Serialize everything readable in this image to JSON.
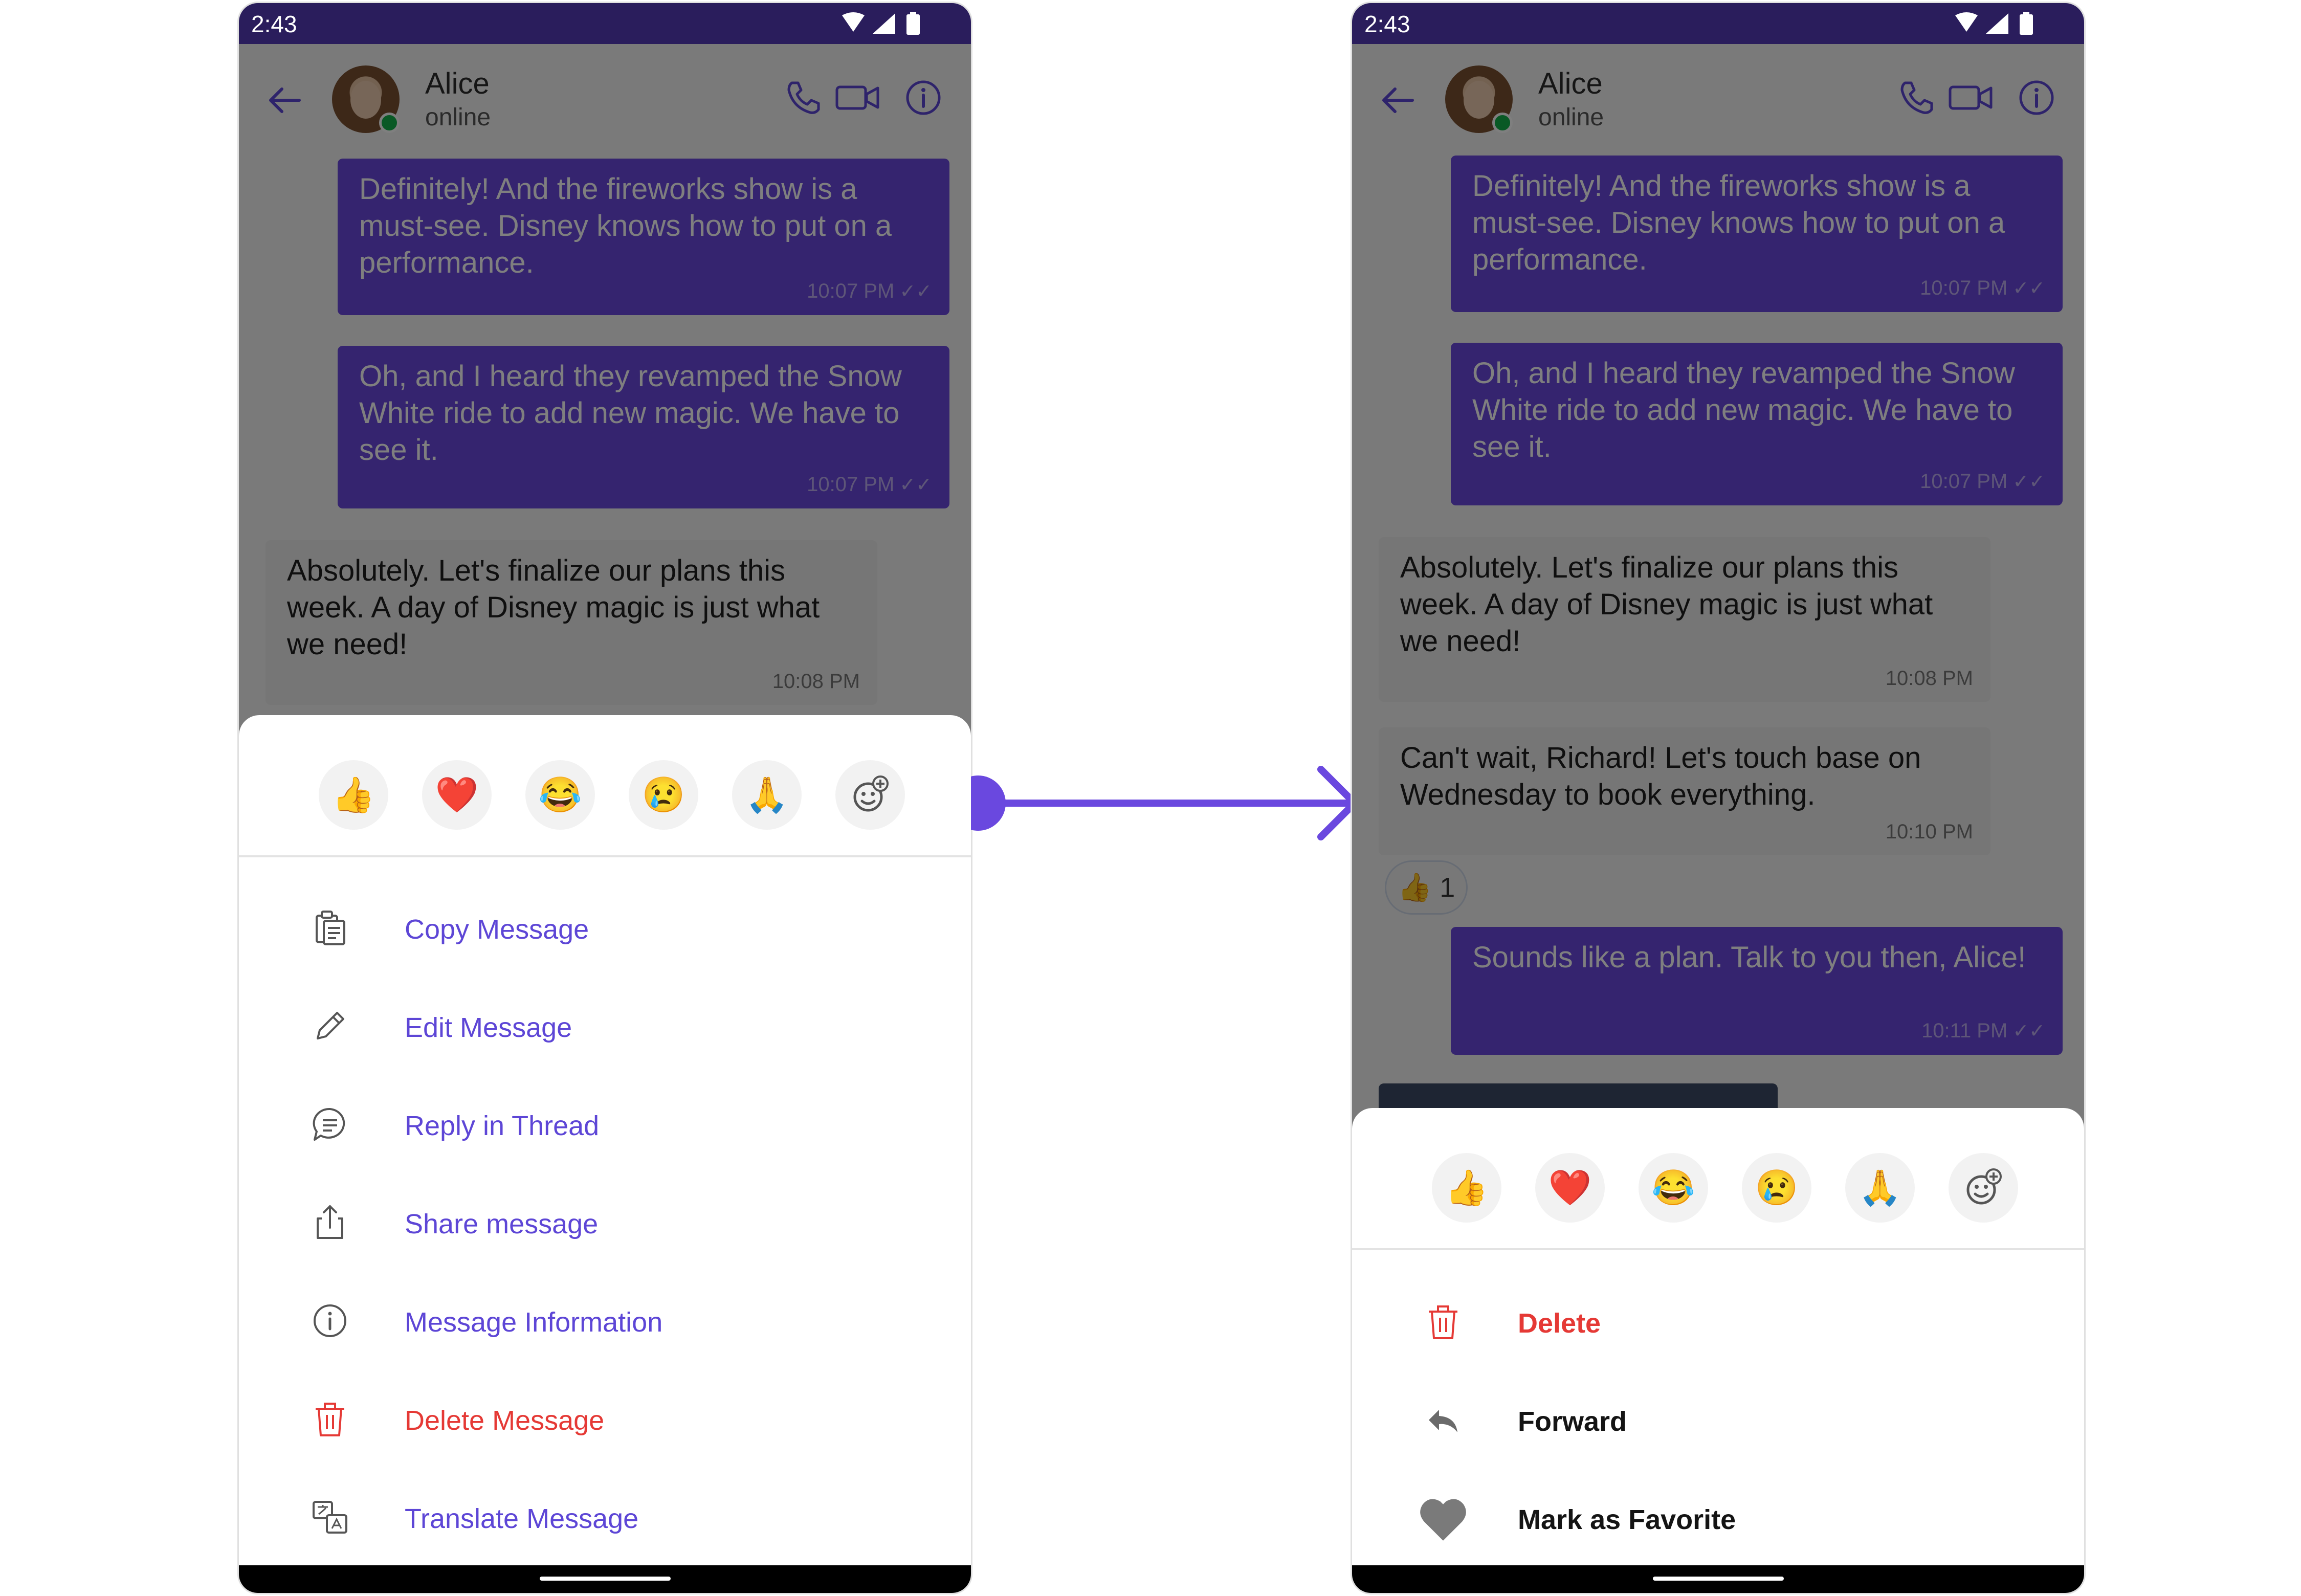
{
  "statusbar": {
    "time": "2:43"
  },
  "chat_header": {
    "name": "Alice",
    "status": "online"
  },
  "left_messages": [
    {
      "text": "Definitely! And the fireworks show is a must-see. Disney knows how to put on a performance.",
      "time": "10:07 PM"
    },
    {
      "text": "Oh, and I heard they revamped the Snow White ride to add new magic. We have to see it.",
      "time": "10:07 PM"
    },
    {
      "text": "Absolutely. Let's finalize our plans this week. A day of Disney magic is just what we need!",
      "time": "10:08 PM"
    }
  ],
  "right_messages": [
    {
      "text": "Definitely! And the fireworks show is a must-see. Disney knows how to put on a performance.",
      "time": "10:07 PM"
    },
    {
      "text": "Oh, and I heard they revamped the Snow White ride to add new magic. We have to see it.",
      "time": "10:07 PM"
    },
    {
      "text": "Absolutely. Let's finalize our plans this week. A day of Disney magic is just what we need!",
      "time": "10:08 PM"
    },
    {
      "text": "Can't wait, Richard! Let's touch base on Wednesday to book everything.",
      "time": "10:10 PM"
    },
    {
      "text": "Sounds like a plan. Talk to you then, Alice!",
      "time": "10:11 PM"
    }
  ],
  "reaction_chip": {
    "emoji": "👍",
    "count": "1"
  },
  "emojis": [
    "👍",
    "❤️",
    "😂",
    "😢",
    "🙏"
  ],
  "left_options": {
    "copy": "Copy Message",
    "edit": "Edit Message",
    "reply_thread": "Reply in Thread",
    "share": "Share message",
    "info": "Message Information",
    "delete": "Delete Message",
    "translate": "Translate Message"
  },
  "right_options": {
    "delete": "Delete",
    "forward": "Forward",
    "favorite": "Mark as Favorite"
  },
  "colors": {
    "accent": "#5d46d6",
    "bubble_outgoing": "#6a48df",
    "danger": "#e53935",
    "online": "#12b34b",
    "statusbar": "#2a1d5c"
  },
  "icons": {
    "copy": "copy-icon",
    "edit": "pencil-icon",
    "reply_thread": "thread-icon",
    "share": "share-icon",
    "info": "info-icon",
    "delete": "trash-icon",
    "translate": "translate-icon",
    "forward": "forward-icon",
    "favorite": "heart-icon",
    "add_reaction": "add-reaction-icon"
  }
}
